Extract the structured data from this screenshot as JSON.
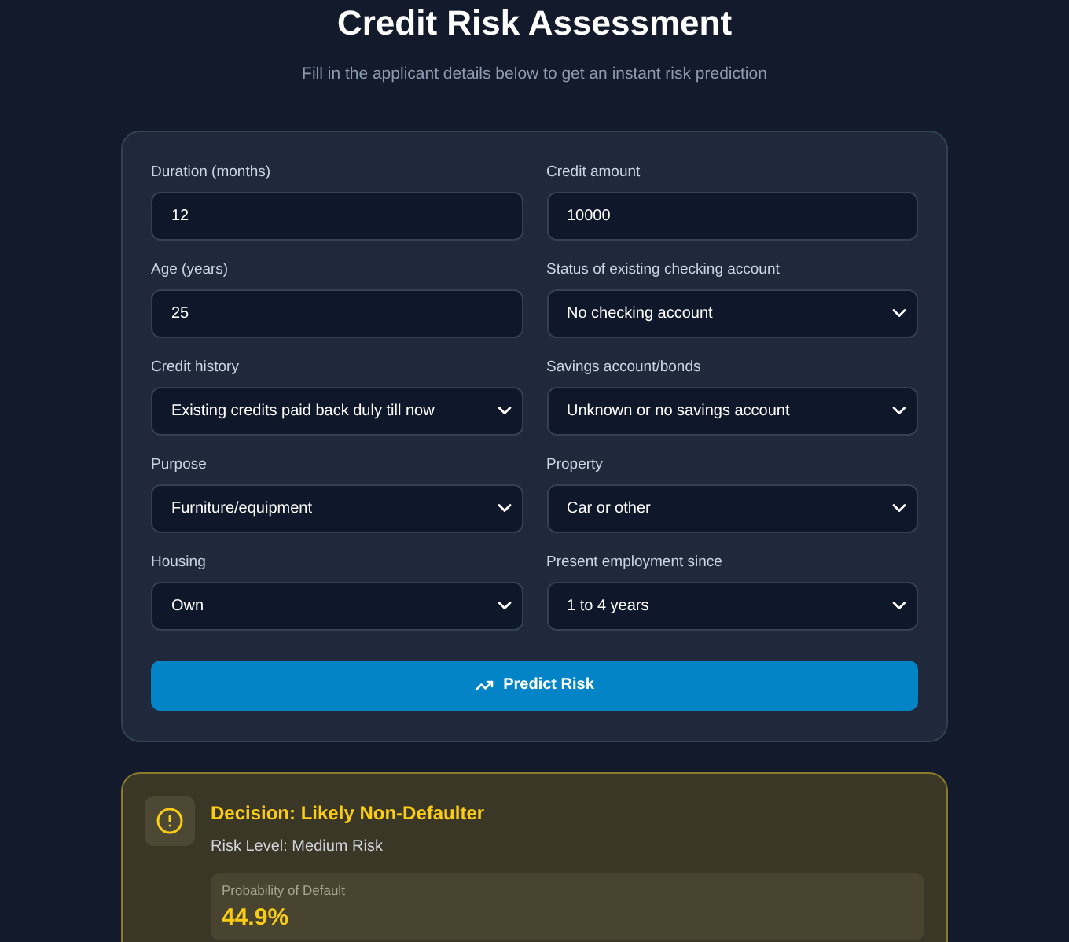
{
  "header": {
    "title": "Credit Risk Assessment",
    "subtitle": "Fill in the applicant details below to get an instant risk prediction"
  },
  "fields": [
    {
      "label": "Duration (months)",
      "kind": "input",
      "value": "12"
    },
    {
      "label": "Credit amount",
      "kind": "input",
      "value": "10000"
    },
    {
      "label": "Age (years)",
      "kind": "input",
      "value": "25"
    },
    {
      "label": "Status of existing checking account",
      "kind": "select",
      "value": "No checking account"
    },
    {
      "label": "Credit history",
      "kind": "select",
      "value": "Existing credits paid back duly till now"
    },
    {
      "label": "Savings account/bonds",
      "kind": "select",
      "value": "Unknown or no savings account"
    },
    {
      "label": "Purpose",
      "kind": "select",
      "value": "Furniture/equipment"
    },
    {
      "label": "Property",
      "kind": "select",
      "value": "Car or other"
    },
    {
      "label": "Housing",
      "kind": "select",
      "value": "Own"
    },
    {
      "label": "Present employment since",
      "kind": "select",
      "value": "1 to 4 years"
    }
  ],
  "button": {
    "label": "Predict Risk"
  },
  "result": {
    "decision": "Decision: Likely Non-Defaulter",
    "risk_level": "Risk Level: Medium Risk",
    "probability_label": "Probability of Default",
    "probability": "44.9%"
  }
}
